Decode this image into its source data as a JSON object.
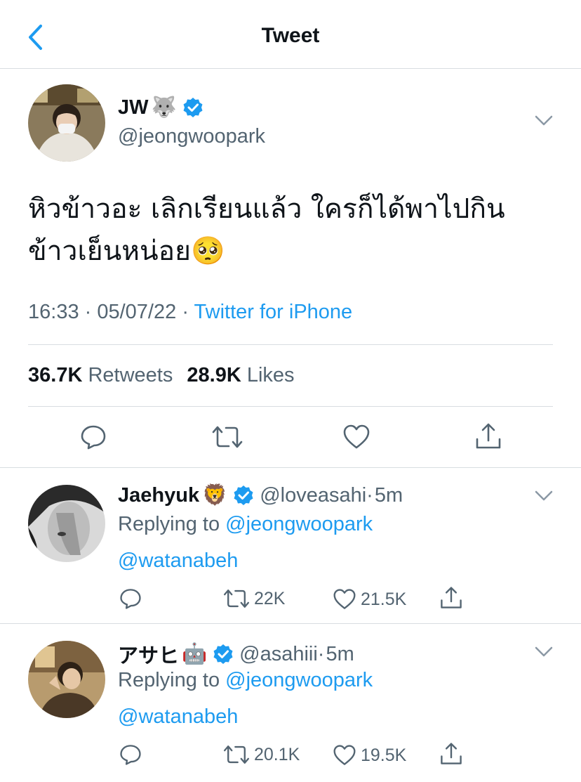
{
  "header": {
    "title": "Tweet"
  },
  "tweet": {
    "name": "JW",
    "name_emoji": "🐺",
    "handle": "@jeongwoopark",
    "text_line1": "หิวข้าวอะ เลิกเรียนแล้ว ใครก็ได้พาไปกิน",
    "text_line2": "ข้าวเย็นหน่อย",
    "text_emoji": "🥺",
    "time": "16:33",
    "date": "05/07/22",
    "source": "Twitter for iPhone",
    "retweets": "36.7K",
    "retweets_label": "Retweets",
    "likes": "28.9K",
    "likes_label": "Likes"
  },
  "replies": [
    {
      "name": "Jaehyuk",
      "name_emoji": "🦁",
      "handle": "@loveasahi",
      "time": "5m",
      "replying_prefix": "Replying to",
      "replying_to": "@jeongwoopark",
      "mention": "@watanabeh",
      "retweets": "22K",
      "likes": "21.5K"
    },
    {
      "name": "アサヒ",
      "name_emoji": "🤖",
      "handle": "@asahiii",
      "time": "5m",
      "replying_prefix": "Replying to",
      "replying_to": "@jeongwoopark",
      "mention": "@watanabeh",
      "retweets": "20.1K",
      "likes": "19.5K"
    }
  ],
  "colors": {
    "accent": "#1d9bf0",
    "secondary_text": "#536471",
    "divider": "#d8dde1"
  }
}
